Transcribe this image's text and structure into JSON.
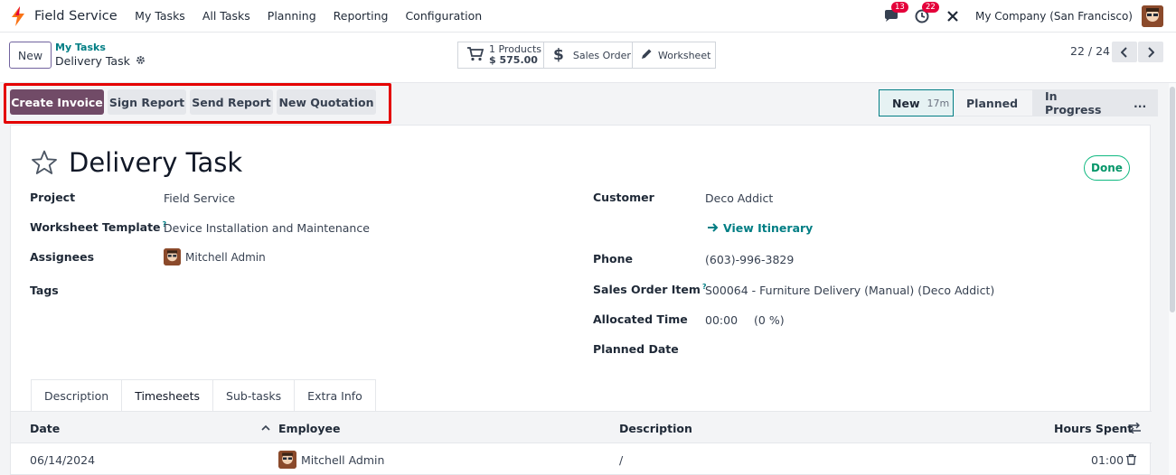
{
  "navbar": {
    "app_name": "Field Service",
    "menu": [
      "My Tasks",
      "All Tasks",
      "Planning",
      "Reporting",
      "Configuration"
    ],
    "chat_badge": "13",
    "activity_badge": "22",
    "company": "My Company (San Francisco)"
  },
  "control_panel": {
    "new_label": "New",
    "breadcrumb_parent": "My Tasks",
    "breadcrumb_current": "Delivery Task",
    "products_count": "1 Products",
    "products_amount": "$ 575.00",
    "sales_order_label": "Sales Order",
    "worksheet_label": "Worksheet",
    "pager": "22 / 24"
  },
  "actions": {
    "create_invoice": "Create Invoice",
    "sign_report": "Sign Report",
    "send_report": "Send Report",
    "new_quotation": "New Quotation"
  },
  "stages": {
    "new": "New",
    "new_duration": "17m",
    "planned": "Planned",
    "in_progress": "In Progress",
    "more": "..."
  },
  "task": {
    "title": "Delivery Task",
    "status": "Done",
    "fields": {
      "project_label": "Project",
      "project_value": "Field Service",
      "worksheet_label": "Worksheet Template",
      "worksheet_value": "Device Installation and Maintenance",
      "assignees_label": "Assignees",
      "assignees_value": "Mitchell Admin",
      "tags_label": "Tags",
      "customer_label": "Customer",
      "customer_value": "Deco Addict",
      "itinerary_link": "View Itinerary",
      "phone_label": "Phone",
      "phone_value": "(603)-996-3829",
      "sol_label": "Sales Order Item",
      "sol_value": "S00064 - Furniture Delivery (Manual) (Deco Addict)",
      "allocated_label": "Allocated Time",
      "allocated_value": "00:00",
      "allocated_pct": "(0 %)",
      "planned_label": "Planned Date",
      "help_marker": "?"
    }
  },
  "tabs": [
    "Description",
    "Timesheets",
    "Sub-tasks",
    "Extra Info"
  ],
  "timesheet": {
    "columns": {
      "date": "Date",
      "employee": "Employee",
      "description": "Description",
      "hours": "Hours Spent"
    },
    "rows": [
      {
        "date": "06/14/2024",
        "employee": "Mitchell Admin",
        "description": "/",
        "hours": "01:00"
      }
    ]
  },
  "colors": {
    "primary": "#714b67",
    "accent": "#017e84",
    "highlight": "#e40000",
    "done": "#10b981"
  },
  "icons": [
    "bolt-icon",
    "chat-icon",
    "clock-icon",
    "tools-icon",
    "gear-icon",
    "cart-icon",
    "dollar-icon",
    "pencil-icon",
    "chevron-left-icon",
    "chevron-right-icon",
    "star-icon",
    "arrow-right-icon",
    "sort-icon",
    "adjust-icon",
    "trash-icon"
  ]
}
